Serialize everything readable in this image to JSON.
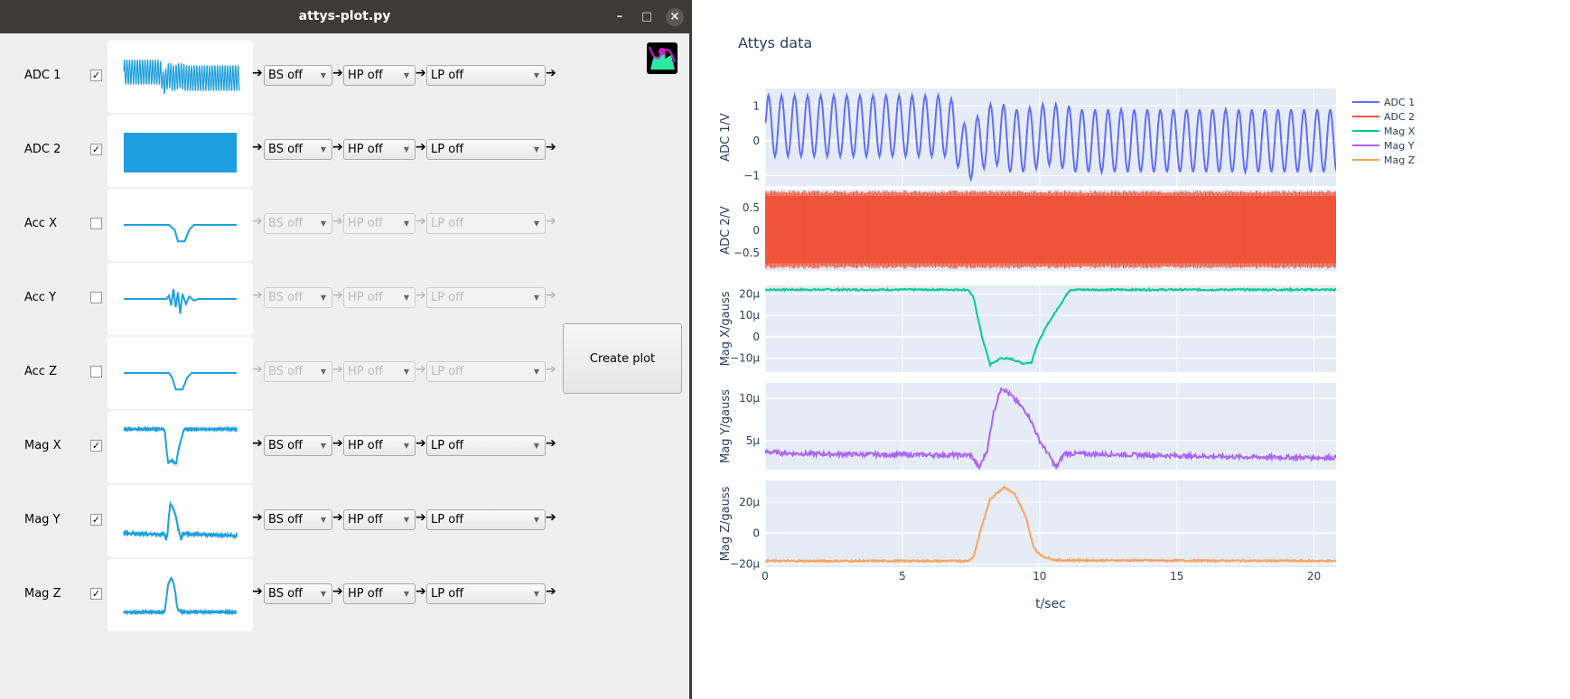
{
  "window": {
    "title": "attys-plot.py",
    "minimize": "–",
    "maximize": "□",
    "close": "×"
  },
  "arrow": "➔",
  "create_button": "Create plot",
  "channels": [
    {
      "label": "ADC 1",
      "checked": true,
      "bs": "BS off",
      "hp": "HP off",
      "lp": "LP off",
      "thumb": "adc1"
    },
    {
      "label": "ADC 2",
      "checked": true,
      "bs": "BS off",
      "hp": "HP off",
      "lp": "LP off",
      "thumb": "adc2"
    },
    {
      "label": "Acc X",
      "checked": false,
      "bs": "BS off",
      "hp": "HP off",
      "lp": "LP off",
      "thumb": "accx"
    },
    {
      "label": "Acc Y",
      "checked": false,
      "bs": "BS off",
      "hp": "HP off",
      "lp": "LP off",
      "thumb": "accy"
    },
    {
      "label": "Acc Z",
      "checked": false,
      "bs": "BS off",
      "hp": "HP off",
      "lp": "LP off",
      "thumb": "accz"
    },
    {
      "label": "Mag X",
      "checked": true,
      "bs": "BS off",
      "hp": "HP off",
      "lp": "LP off",
      "thumb": "magx"
    },
    {
      "label": "Mag Y",
      "checked": true,
      "bs": "BS off",
      "hp": "HP off",
      "lp": "LP off",
      "thumb": "magy"
    },
    {
      "label": "Mag Z",
      "checked": true,
      "bs": "BS off",
      "hp": "HP off",
      "lp": "LP off",
      "thumb": "magz"
    }
  ],
  "thumb_color": "#1e9fdf",
  "thumbnails": {
    "accx": [
      [
        0,
        0
      ],
      [
        0.4,
        0
      ],
      [
        0.45,
        -0.3
      ],
      [
        0.48,
        -1
      ],
      [
        0.54,
        -1
      ],
      [
        0.58,
        -0.3
      ],
      [
        0.62,
        0
      ],
      [
        1,
        0
      ]
    ],
    "accy": [
      [
        0,
        0
      ],
      [
        0.38,
        0
      ],
      [
        0.4,
        0.2
      ],
      [
        0.42,
        -0.4
      ],
      [
        0.44,
        0.6
      ],
      [
        0.46,
        -0.5
      ],
      [
        0.48,
        0.4
      ],
      [
        0.5,
        -0.9
      ],
      [
        0.52,
        0.3
      ],
      [
        0.55,
        -0.3
      ],
      [
        0.58,
        0.15
      ],
      [
        0.62,
        -0.1
      ],
      [
        0.66,
        0
      ],
      [
        1,
        0
      ]
    ],
    "accz": [
      [
        0,
        0
      ],
      [
        0.4,
        0
      ],
      [
        0.43,
        -0.3
      ],
      [
        0.46,
        -1
      ],
      [
        0.52,
        -1
      ],
      [
        0.56,
        -0.3
      ],
      [
        0.6,
        0
      ],
      [
        1,
        0
      ]
    ]
  },
  "chart_data": {
    "type": "line",
    "title": "Attys data",
    "xlabel": "t/sec",
    "xlim": [
      0,
      20.8
    ],
    "xticks": [
      "0",
      "5",
      "10",
      "15",
      "20"
    ],
    "xtick_values": [
      0,
      5,
      10,
      15,
      20
    ],
    "grid": true,
    "legend_placement": "top-right",
    "subplots": [
      {
        "name": "ADC 1",
        "ylabel": "ADC 1/V",
        "color": "#636efa",
        "ylim": [
          -1.3,
          1.5
        ],
        "yticks": [
          "1",
          "0",
          "−1"
        ],
        "ytick_values": [
          1,
          0,
          -1
        ],
        "extrema_start": 0.12,
        "extrema_step": 0.238,
        "start_value": 0.5,
        "extrema": [
          1.3,
          -0.45,
          1.3,
          -0.45,
          1.3,
          -0.45,
          1.3,
          -0.45,
          1.3,
          -0.45,
          1.3,
          -0.45,
          1.3,
          -0.45,
          1.3,
          -0.45,
          1.3,
          -0.45,
          1.3,
          -0.45,
          1.3,
          -0.45,
          1.3,
          -0.45,
          1.3,
          -0.45,
          1.3,
          -0.45,
          1.2,
          -0.75,
          0.5,
          -1.1,
          0.7,
          -0.8,
          1.05,
          -0.7,
          1.05,
          -0.9,
          0.9,
          -0.9,
          0.95,
          -0.8,
          1.05,
          -0.7,
          1.05,
          -0.8,
          1.0,
          -0.9,
          0.9,
          -0.9,
          0.9,
          -0.9,
          0.9,
          -0.9,
          0.9,
          -0.9,
          0.9,
          -0.9,
          0.9,
          -0.9,
          0.9,
          -0.9,
          0.9,
          -0.9,
          0.9,
          -0.9,
          0.9,
          -0.9,
          0.9,
          -0.9,
          0.9,
          -0.9,
          0.9,
          -0.9,
          0.9,
          -0.9,
          0.9,
          -0.9,
          0.9,
          -0.9,
          0.9,
          -0.9,
          0.9,
          -0.9,
          0.9,
          -0.9,
          0.9,
          -0.9,
          0.9,
          -0.9
        ]
      },
      {
        "name": "ADC 2",
        "ylabel": "ADC 2/V",
        "color": "#ef553b",
        "ylim": [
          -0.9,
          0.9
        ],
        "yticks": [
          "0.5",
          "0",
          "−0.5"
        ],
        "ytick_values": [
          0.5,
          0,
          -0.5
        ],
        "envelope": [
          -0.85,
          0.88
        ],
        "frequency_hz": 50
      },
      {
        "name": "Mag X",
        "ylabel": "Mag X/gauss",
        "color": "#00cc96",
        "ylim": [
          -16.5,
          24
        ],
        "yticks": [
          "20μ",
          "10μ",
          "0",
          "−10μ"
        ],
        "ytick_values": [
          20,
          10,
          0,
          -10
        ],
        "points": [
          [
            0,
            22
          ],
          [
            7.4,
            22
          ],
          [
            7.6,
            18
          ],
          [
            7.9,
            0
          ],
          [
            8.2,
            -13
          ],
          [
            8.6,
            -10
          ],
          [
            9,
            -10.5
          ],
          [
            9.4,
            -12.5
          ],
          [
            9.7,
            -12
          ],
          [
            9.9,
            -4
          ],
          [
            10.3,
            6
          ],
          [
            10.7,
            14
          ],
          [
            11.1,
            22
          ],
          [
            20.8,
            22
          ]
        ]
      },
      {
        "name": "Mag Y",
        "ylabel": "Mag Y/gauss",
        "color": "#ab63fa",
        "ylim": [
          1.6,
          11.8
        ],
        "yticks": [
          "10μ",
          "5μ"
        ],
        "ytick_values": [
          10,
          5
        ],
        "points": [
          [
            0,
            3.7
          ],
          [
            1,
            3.5
          ],
          [
            3,
            3.4
          ],
          [
            7.5,
            3.3
          ],
          [
            7.8,
            1.8
          ],
          [
            8.1,
            4
          ],
          [
            8.3,
            8
          ],
          [
            8.6,
            11.3
          ],
          [
            8.9,
            10.5
          ],
          [
            9.2,
            9.5
          ],
          [
            9.6,
            8
          ],
          [
            10,
            5
          ],
          [
            10.4,
            3
          ],
          [
            10.6,
            1.8
          ],
          [
            10.9,
            3.5
          ],
          [
            14,
            3.3
          ],
          [
            17,
            3.1
          ],
          [
            20.8,
            3
          ]
        ]
      },
      {
        "name": "Mag Z",
        "ylabel": "Mag Z/gauss",
        "color": "#ffa15a",
        "ylim": [
          -22,
          34
        ],
        "yticks": [
          "20μ",
          "0",
          "−20μ"
        ],
        "ytick_values": [
          20,
          0,
          -20
        ],
        "points": [
          [
            0,
            -18
          ],
          [
            7.4,
            -18
          ],
          [
            7.6,
            -15
          ],
          [
            7.9,
            5
          ],
          [
            8.2,
            22
          ],
          [
            8.7,
            30
          ],
          [
            9.1,
            25
          ],
          [
            9.5,
            10
          ],
          [
            9.8,
            -10
          ],
          [
            10.1,
            -15
          ],
          [
            10.6,
            -17.5
          ],
          [
            20.8,
            -18
          ]
        ]
      }
    ]
  }
}
